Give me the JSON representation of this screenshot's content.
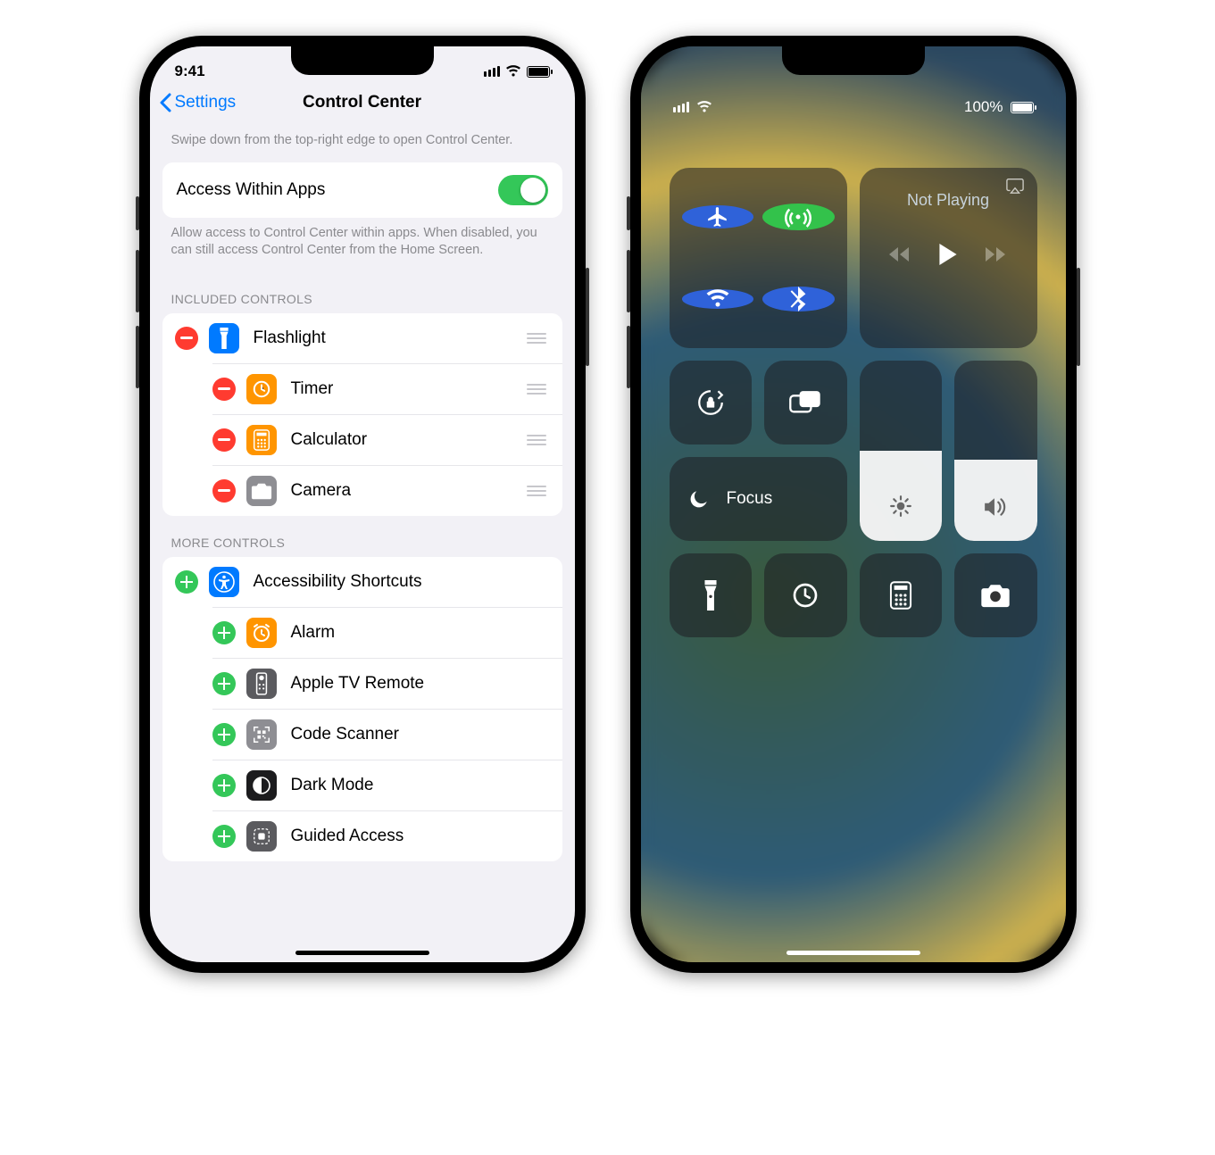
{
  "left": {
    "status": {
      "time": "9:41"
    },
    "nav": {
      "back": "Settings",
      "title": "Control Center"
    },
    "intro": "Swipe down from the top-right edge to open Control Center.",
    "access": {
      "label": "Access Within Apps",
      "desc": "Allow access to Control Center within apps. When disabled, you can still access Control Center from the Home Screen.",
      "on": true
    },
    "included": {
      "header": "INCLUDED CONTROLS",
      "items": [
        {
          "label": "Flashlight",
          "icon": "flashlight-icon",
          "bg": "ic-blue"
        },
        {
          "label": "Timer",
          "icon": "timer-icon",
          "bg": "ic-orange"
        },
        {
          "label": "Calculator",
          "icon": "calculator-icon",
          "bg": "ic-orange"
        },
        {
          "label": "Camera",
          "icon": "camera-icon",
          "bg": "ic-gray"
        }
      ]
    },
    "more": {
      "header": "MORE CONTROLS",
      "items": [
        {
          "label": "Accessibility Shortcuts",
          "icon": "accessibility-icon",
          "bg": "ic-blue"
        },
        {
          "label": "Alarm",
          "icon": "alarm-icon",
          "bg": "ic-orange"
        },
        {
          "label": "Apple TV Remote",
          "icon": "remote-icon",
          "bg": "ic-darkgray"
        },
        {
          "label": "Code Scanner",
          "icon": "qr-icon",
          "bg": "ic-gray"
        },
        {
          "label": "Dark Mode",
          "icon": "darkmode-icon",
          "bg": "ic-black"
        },
        {
          "label": "Guided Access",
          "icon": "guided-icon",
          "bg": "ic-darkgray"
        }
      ]
    }
  },
  "right": {
    "status": {
      "battery": "100%"
    },
    "media": {
      "title": "Not Playing"
    },
    "focus": {
      "label": "Focus"
    },
    "brightness_pct": 50,
    "volume_pct": 45,
    "connectivity": {
      "airplane": {
        "on": false,
        "color": "#2f62d9"
      },
      "cellular": {
        "on": true,
        "color": "#33c24b"
      },
      "wifi": {
        "on": true,
        "color": "#2f62d9"
      },
      "bluetooth": {
        "on": true,
        "color": "#2f62d9"
      }
    },
    "bottom_tiles": [
      "flashlight-icon",
      "timer-icon",
      "calculator-icon",
      "camera-icon"
    ]
  }
}
